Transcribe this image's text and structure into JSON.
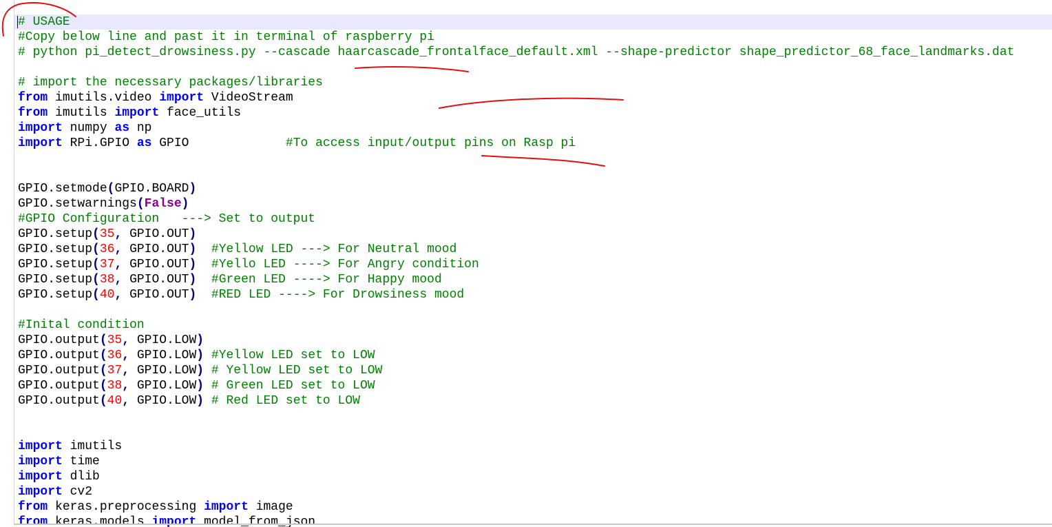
{
  "colors": {
    "keyword": "#0000ff",
    "comment": "#008000",
    "number": "#ff0000",
    "constant": "#880088",
    "operator": "#000080",
    "text": "#000000",
    "current_line": "#e8e8ff",
    "annotation": "#e01010"
  },
  "code_lines": [
    [
      {
        "t": "cm",
        "v": "# USAGE"
      }
    ],
    [
      {
        "t": "cm",
        "v": "#Copy below line and past it in terminal of raspberry pi"
      }
    ],
    [
      {
        "t": "cm",
        "v": "# python pi_detect_drowsiness.py --cascade haarcascade_frontalface_default.xml --shape-predictor shape_predictor_68_face_landmarks.dat"
      }
    ],
    [],
    [
      {
        "t": "cm",
        "v": "# import the necessary packages/libraries"
      }
    ],
    [
      {
        "t": "kw",
        "v": "from"
      },
      {
        "t": "tx",
        "v": " imutils.video "
      },
      {
        "t": "kw",
        "v": "import"
      },
      {
        "t": "tx",
        "v": " VideoStream"
      }
    ],
    [
      {
        "t": "kw",
        "v": "from"
      },
      {
        "t": "tx",
        "v": " imutils "
      },
      {
        "t": "kw",
        "v": "import"
      },
      {
        "t": "tx",
        "v": " face_utils"
      }
    ],
    [
      {
        "t": "kw",
        "v": "import"
      },
      {
        "t": "tx",
        "v": " numpy "
      },
      {
        "t": "kw",
        "v": "as"
      },
      {
        "t": "tx",
        "v": " np"
      }
    ],
    [
      {
        "t": "kw",
        "v": "import"
      },
      {
        "t": "tx",
        "v": " RPi.GPIO "
      },
      {
        "t": "kw",
        "v": "as"
      },
      {
        "t": "tx",
        "v": " GPIO             "
      },
      {
        "t": "cm",
        "v": "#To access input/output pins on Rasp pi"
      }
    ],
    [],
    [],
    [
      {
        "t": "tx",
        "v": "GPIO.setmode"
      },
      {
        "t": "op",
        "v": "("
      },
      {
        "t": "tx",
        "v": "GPIO.BOARD"
      },
      {
        "t": "op",
        "v": ")"
      }
    ],
    [
      {
        "t": "tx",
        "v": "GPIO.setwarnings"
      },
      {
        "t": "op",
        "v": "("
      },
      {
        "t": "const",
        "v": "False"
      },
      {
        "t": "op",
        "v": ")"
      }
    ],
    [
      {
        "t": "cm",
        "v": "#GPIO Configuration   ---> Set to output"
      }
    ],
    [
      {
        "t": "tx",
        "v": "GPIO.setup"
      },
      {
        "t": "op",
        "v": "("
      },
      {
        "t": "num",
        "v": "35"
      },
      {
        "t": "op",
        "v": ","
      },
      {
        "t": "tx",
        "v": " GPIO.OUT"
      },
      {
        "t": "op",
        "v": ")"
      }
    ],
    [
      {
        "t": "tx",
        "v": "GPIO.setup"
      },
      {
        "t": "op",
        "v": "("
      },
      {
        "t": "num",
        "v": "36"
      },
      {
        "t": "op",
        "v": ","
      },
      {
        "t": "tx",
        "v": " GPIO.OUT"
      },
      {
        "t": "op",
        "v": ")"
      },
      {
        "t": "tx",
        "v": "  "
      },
      {
        "t": "cm",
        "v": "#Yellow LED ---> For Neutral mood"
      }
    ],
    [
      {
        "t": "tx",
        "v": "GPIO.setup"
      },
      {
        "t": "op",
        "v": "("
      },
      {
        "t": "num",
        "v": "37"
      },
      {
        "t": "op",
        "v": ","
      },
      {
        "t": "tx",
        "v": " GPIO.OUT"
      },
      {
        "t": "op",
        "v": ")"
      },
      {
        "t": "tx",
        "v": "  "
      },
      {
        "t": "cm",
        "v": "#Yello LED ----> For Angry condition"
      }
    ],
    [
      {
        "t": "tx",
        "v": "GPIO.setup"
      },
      {
        "t": "op",
        "v": "("
      },
      {
        "t": "num",
        "v": "38"
      },
      {
        "t": "op",
        "v": ","
      },
      {
        "t": "tx",
        "v": " GPIO.OUT"
      },
      {
        "t": "op",
        "v": ")"
      },
      {
        "t": "tx",
        "v": "  "
      },
      {
        "t": "cm",
        "v": "#Green LED ----> For Happy mood"
      }
    ],
    [
      {
        "t": "tx",
        "v": "GPIO.setup"
      },
      {
        "t": "op",
        "v": "("
      },
      {
        "t": "num",
        "v": "40"
      },
      {
        "t": "op",
        "v": ","
      },
      {
        "t": "tx",
        "v": " GPIO.OUT"
      },
      {
        "t": "op",
        "v": ")"
      },
      {
        "t": "tx",
        "v": "  "
      },
      {
        "t": "cm",
        "v": "#RED LED ----> For Drowsiness mood"
      }
    ],
    [],
    [
      {
        "t": "cm",
        "v": "#Inital condition"
      }
    ],
    [
      {
        "t": "tx",
        "v": "GPIO.output"
      },
      {
        "t": "op",
        "v": "("
      },
      {
        "t": "num",
        "v": "35"
      },
      {
        "t": "op",
        "v": ","
      },
      {
        "t": "tx",
        "v": " GPIO.LOW"
      },
      {
        "t": "op",
        "v": ")"
      }
    ],
    [
      {
        "t": "tx",
        "v": "GPIO.output"
      },
      {
        "t": "op",
        "v": "("
      },
      {
        "t": "num",
        "v": "36"
      },
      {
        "t": "op",
        "v": ","
      },
      {
        "t": "tx",
        "v": " GPIO.LOW"
      },
      {
        "t": "op",
        "v": ")"
      },
      {
        "t": "tx",
        "v": " "
      },
      {
        "t": "cm",
        "v": "#Yellow LED set to LOW"
      }
    ],
    [
      {
        "t": "tx",
        "v": "GPIO.output"
      },
      {
        "t": "op",
        "v": "("
      },
      {
        "t": "num",
        "v": "37"
      },
      {
        "t": "op",
        "v": ","
      },
      {
        "t": "tx",
        "v": " GPIO.LOW"
      },
      {
        "t": "op",
        "v": ")"
      },
      {
        "t": "tx",
        "v": " "
      },
      {
        "t": "cm",
        "v": "# Yellow LED set to LOW"
      }
    ],
    [
      {
        "t": "tx",
        "v": "GPIO.output"
      },
      {
        "t": "op",
        "v": "("
      },
      {
        "t": "num",
        "v": "38"
      },
      {
        "t": "op",
        "v": ","
      },
      {
        "t": "tx",
        "v": " GPIO.LOW"
      },
      {
        "t": "op",
        "v": ")"
      },
      {
        "t": "tx",
        "v": " "
      },
      {
        "t": "cm",
        "v": "# Green LED set to LOW"
      }
    ],
    [
      {
        "t": "tx",
        "v": "GPIO.output"
      },
      {
        "t": "op",
        "v": "("
      },
      {
        "t": "num",
        "v": "40"
      },
      {
        "t": "op",
        "v": ","
      },
      {
        "t": "tx",
        "v": " GPIO.LOW"
      },
      {
        "t": "op",
        "v": ")"
      },
      {
        "t": "tx",
        "v": " "
      },
      {
        "t": "cm",
        "v": "# Red LED set to LOW"
      }
    ],
    [],
    [],
    [
      {
        "t": "kw",
        "v": "import"
      },
      {
        "t": "tx",
        "v": " imutils"
      }
    ],
    [
      {
        "t": "kw",
        "v": "import"
      },
      {
        "t": "tx",
        "v": " time"
      }
    ],
    [
      {
        "t": "kw",
        "v": "import"
      },
      {
        "t": "tx",
        "v": " dlib"
      }
    ],
    [
      {
        "t": "kw",
        "v": "import"
      },
      {
        "t": "tx",
        "v": " cv2"
      }
    ],
    [
      {
        "t": "kw",
        "v": "from"
      },
      {
        "t": "tx",
        "v": " keras.preprocessing "
      },
      {
        "t": "kw",
        "v": "import"
      },
      {
        "t": "tx",
        "v": " image"
      }
    ],
    [
      {
        "t": "kw",
        "v": "from"
      },
      {
        "t": "tx",
        "v": " keras.models "
      },
      {
        "t": "kw",
        "v": "import"
      },
      {
        "t": "tx",
        "v": " model_from_json"
      }
    ]
  ]
}
